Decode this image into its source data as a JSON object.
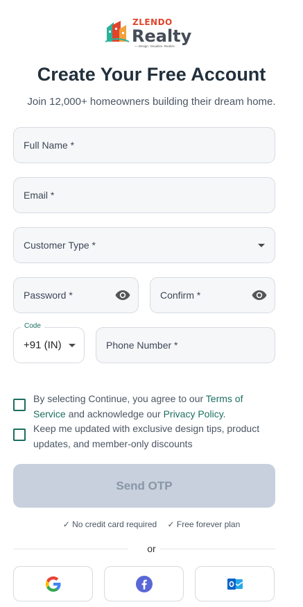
{
  "brand": {
    "top_word": "ZLENDO",
    "main_word": "Realty",
    "tagline": "— Design. Visualize. Realize."
  },
  "header": {
    "title": "Create Your Free Account",
    "subtitle": "Join 12,000+ homeowners building their dream home."
  },
  "form": {
    "full_name_placeholder": "Full Name *",
    "email_placeholder": "Email *",
    "customer_type_placeholder": "Customer Type *",
    "password_placeholder": "Password *",
    "confirm_placeholder": "Confirm *",
    "code_label": "Code",
    "code_value": "+91 (IN)",
    "phone_placeholder": "Phone Number *"
  },
  "consent": {
    "terms_prefix": "By selecting Continue, you agree to our ",
    "terms_link": "Terms of Service",
    "terms_middle": " and acknowledge our ",
    "privacy_link": "Privacy Policy",
    "terms_suffix": ".",
    "updates_text": "Keep me updated with exclusive design tips, product updates, and member-only discounts"
  },
  "actions": {
    "send_otp": "Send OTP"
  },
  "perks": {
    "no_card": "✓ No credit card required",
    "free_plan": "✓ Free forever plan"
  },
  "divider_text": "or",
  "social": [
    "google-icon",
    "facebook-icon",
    "outlook-icon"
  ],
  "colors": {
    "accent": "#1b6e5f",
    "disabled_button": "#c7d0dc",
    "brand_red": "#e0452b"
  }
}
